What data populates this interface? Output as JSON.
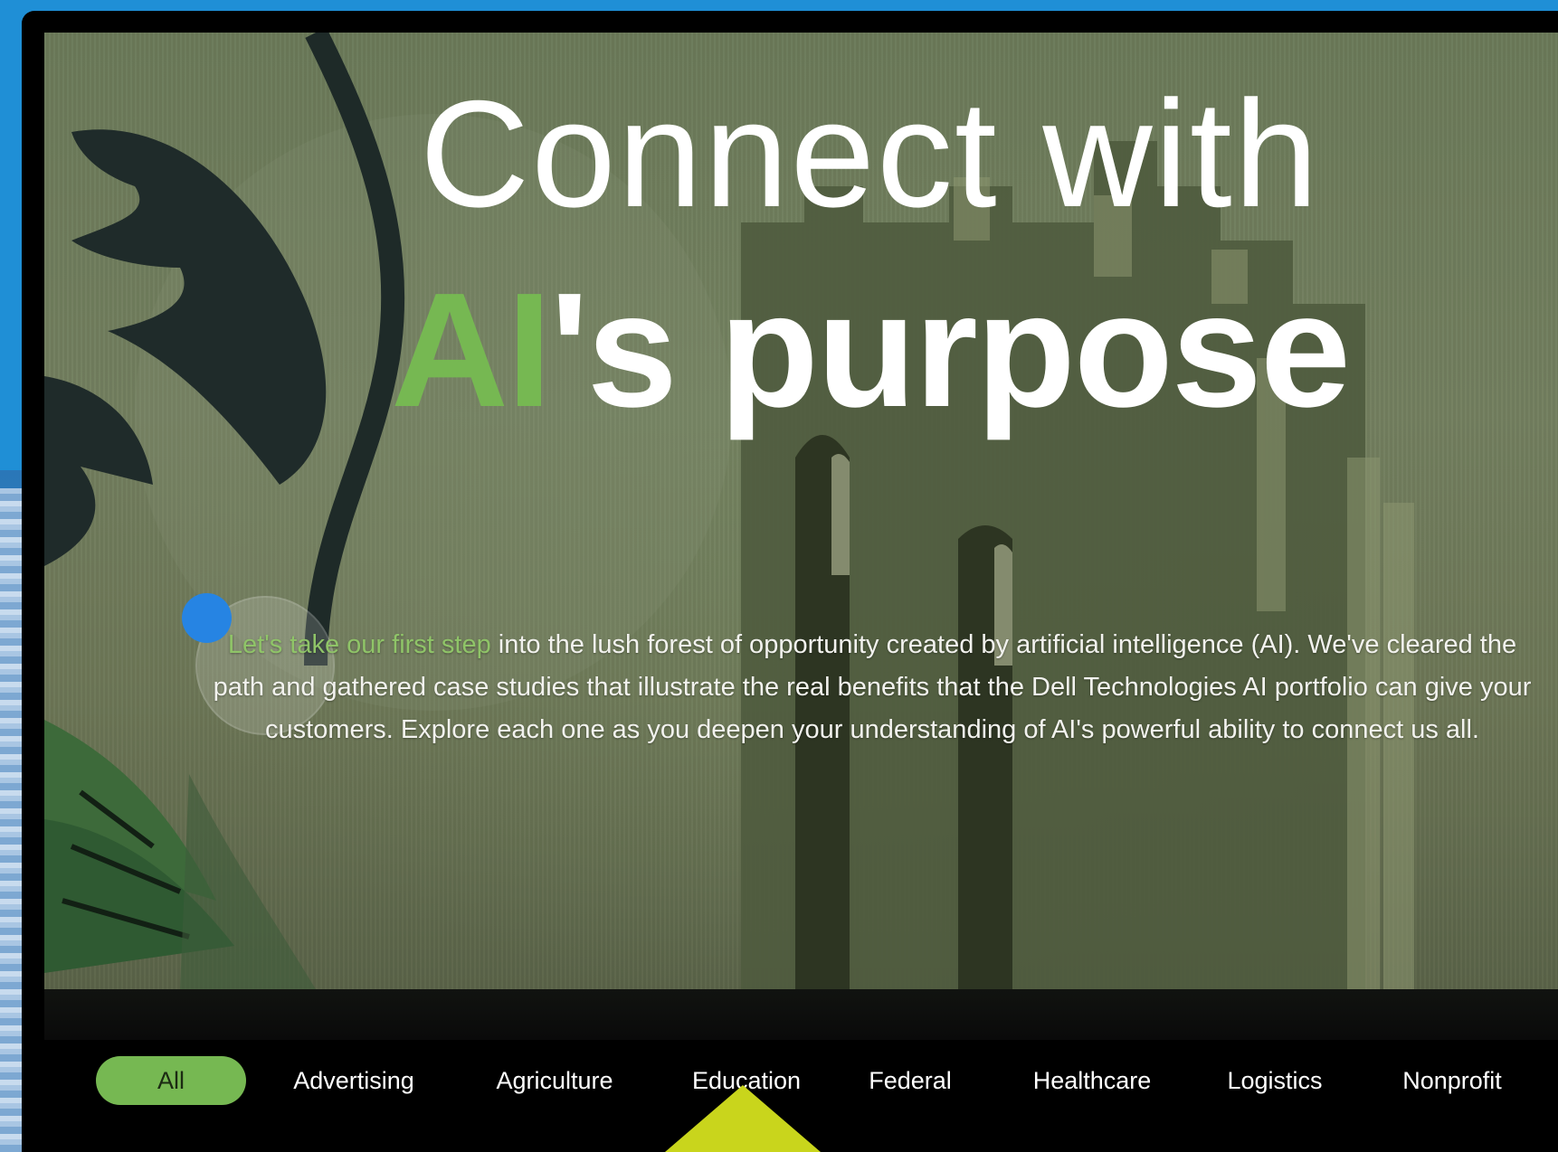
{
  "hero": {
    "headline_line1": "Connect with",
    "headline_accent": "AI",
    "headline_rest": "'s purpose",
    "intro_lead": "Let's take our first step",
    "intro_body": " into the lush forest of opportunity created by artificial intelligence (AI). We've cleared the path and gathered case studies that illustrate the real benefits that the Dell Technologies AI portfolio can give your customers. Explore each one as you deepen your understanding of AI's powerful ability to connect us all."
  },
  "tabs": {
    "selected": "All",
    "items": [
      {
        "label": "All"
      },
      {
        "label": "Advertising"
      },
      {
        "label": "Agriculture"
      },
      {
        "label": "Education"
      },
      {
        "label": "Federal"
      },
      {
        "label": "Healthcare"
      },
      {
        "label": "Logistics"
      },
      {
        "label": "Nonprofit"
      }
    ]
  },
  "colors": {
    "accent_green": "#76b852",
    "page_blue": "#1f8fd6",
    "pointer_yellow": "#c9d51c",
    "frame_black": "#000000"
  },
  "icons": {
    "cursor": "cursor-dot-icon",
    "pointer": "selection-pointer-icon"
  }
}
